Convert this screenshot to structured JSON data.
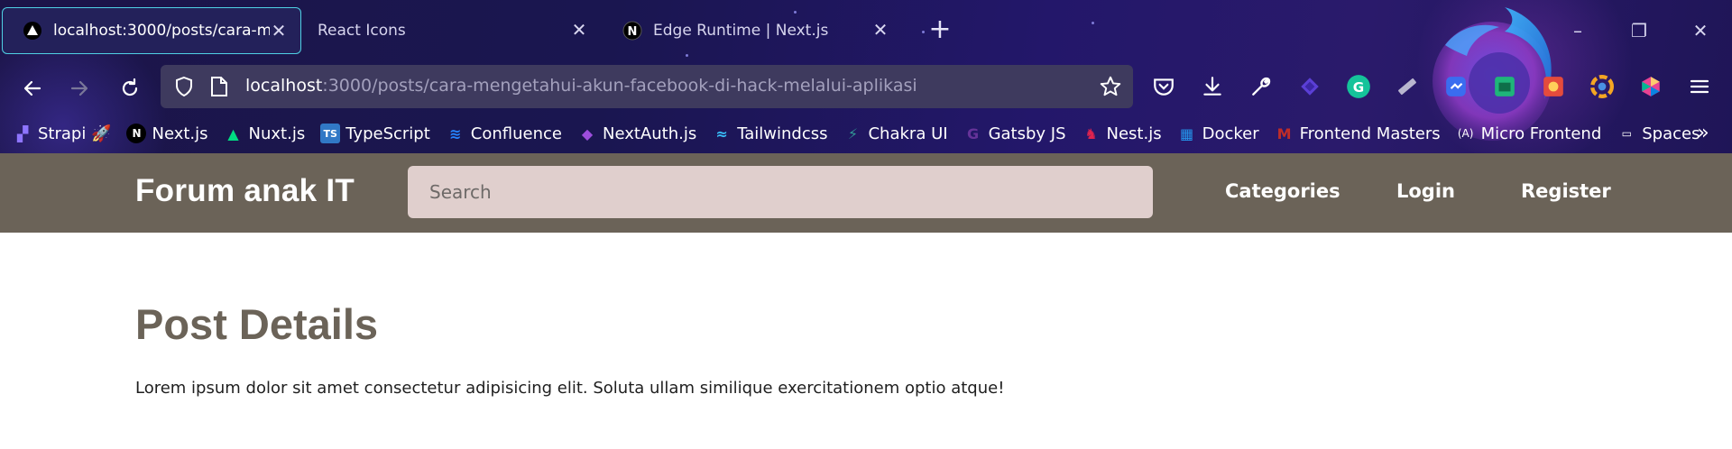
{
  "browser": {
    "tabs": [
      {
        "title": "localhost:3000/posts/cara-mengetahui-akun-facebook-di-hack-melalui-aplikasi",
        "active": true,
        "favicon": "triangle-icon"
      },
      {
        "title": "React Icons",
        "active": false,
        "favicon": ""
      },
      {
        "title": "Edge Runtime | Next.js",
        "active": false,
        "favicon": "nextjs-icon"
      }
    ],
    "url": {
      "host": "localhost",
      "rest": ":3000/posts/cara-mengetahui-akun-facebook-di-hack-melalui-aplikasi"
    },
    "bookmarks": [
      {
        "label": "Strapi 🚀",
        "icon": "strapi-icon",
        "color": "#8e75ff"
      },
      {
        "label": "Next.js",
        "icon": "nextjs-icon",
        "color": "#000000"
      },
      {
        "label": "Nuxt.js",
        "icon": "nuxt-icon",
        "color": "#00dc82"
      },
      {
        "label": "TypeScript",
        "icon": "typescript-icon",
        "color": "#3178c6"
      },
      {
        "label": "Confluence",
        "icon": "confluence-icon",
        "color": "#2684ff"
      },
      {
        "label": "NextAuth.js",
        "icon": "nextauth-icon",
        "color": "#9d4edd"
      },
      {
        "label": "Tailwindcss",
        "icon": "tailwind-icon",
        "color": "#38bdf8"
      },
      {
        "label": "Chakra UI",
        "icon": "chakra-icon",
        "color": "#319795"
      },
      {
        "label": "Gatsby JS",
        "icon": "gatsby-icon",
        "color": "#663399"
      },
      {
        "label": "Nest.js",
        "icon": "nestjs-icon",
        "color": "#e0234e"
      },
      {
        "label": "Docker",
        "icon": "docker-icon",
        "color": "#2496ed"
      },
      {
        "label": "Frontend Masters",
        "icon": "frontendmasters-icon",
        "color": "#c02d28"
      },
      {
        "label": "Micro Frontend",
        "icon": "microfrontend-icon",
        "color": "#ffffff"
      },
      {
        "label": "Spaces",
        "icon": "folder-icon",
        "color": "#ffffff"
      }
    ]
  },
  "site": {
    "brand": "Forum anak IT",
    "search_placeholder": "Search",
    "nav": {
      "categories": "Categories",
      "login": "Login",
      "register": "Register"
    },
    "header_color": "#6b6358",
    "search_bg": "#e0cfcd"
  },
  "post": {
    "heading": "Post Details",
    "body": "Lorem ipsum dolor sit amet consectetur adipisicing elit. Soluta ullam similique exercitationem optio atque!"
  }
}
